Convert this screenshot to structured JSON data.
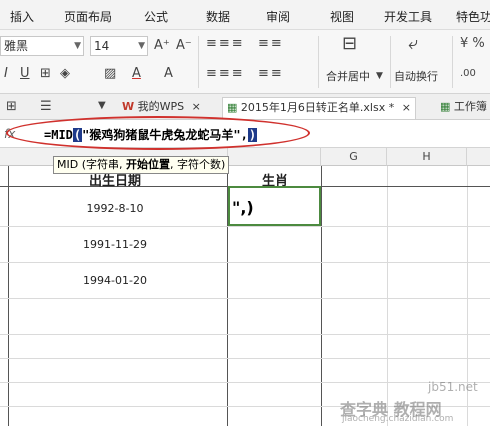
{
  "menu": [
    "插入",
    "页面布局",
    "公式",
    "数据",
    "审阅",
    "视图",
    "开发工具",
    "特色功"
  ],
  "ribbon": {
    "font_name": "雅黑",
    "font_size": "14",
    "font_buttons": [
      "A⁺",
      "A⁻"
    ],
    "format_buttons": [
      "I",
      "U",
      "A",
      "A"
    ],
    "merge_label": "合并居中",
    "wrap_label": "自动换行"
  },
  "tabs": {
    "wps_label": "我的WPS",
    "file_label": "2015年1月6日转正名单.xlsx *",
    "workbook_label": "工作簿"
  },
  "formula_bar": {
    "fx": "fx",
    "func": "=MID",
    "open": "(",
    "arg": "\"猴鸡狗猪鼠牛虎兔龙蛇马羊\"",
    "sep": ",",
    "close": ")"
  },
  "tooltip": {
    "pre": "MID (字符串, ",
    "bold": "开始位置",
    "post": ", 字符个数)"
  },
  "columns": [
    "G",
    "H"
  ],
  "table": {
    "header_birth": "出生日期",
    "header_zodiac": "生肖",
    "dates": [
      "1992-8-10",
      "1991-11-29",
      "1994-01-20"
    ],
    "editing_text": "\",)"
  },
  "watermark": {
    "line1": "jb51.net",
    "line2": "查字典 教程网",
    "line3": "jiaocheng.chazidian.com"
  },
  "colors": {
    "accent_red": "#d0312d",
    "highlight_blue": "#1e3a8a",
    "cell_border_green": "#4c8a3f"
  }
}
